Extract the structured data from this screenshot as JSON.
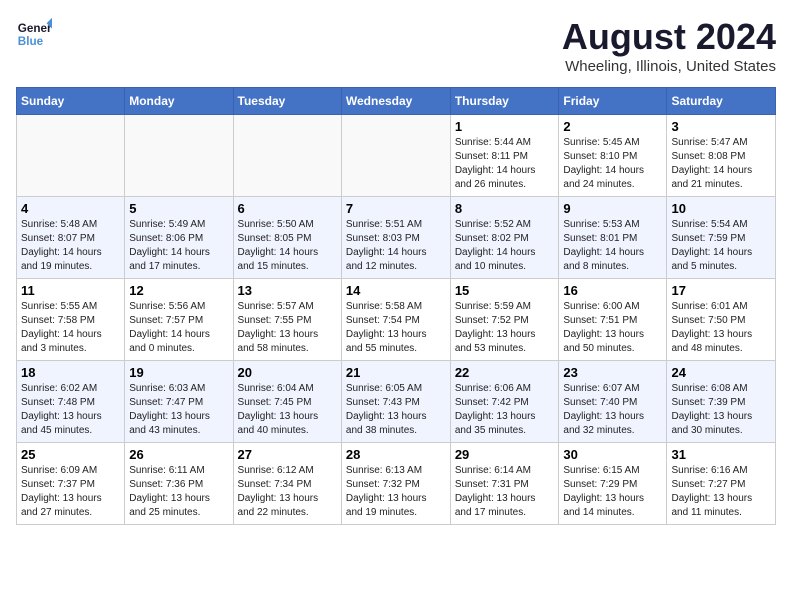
{
  "logo": {
    "line1": "General",
    "line2": "Blue"
  },
  "title": "August 2024",
  "subtitle": "Wheeling, Illinois, United States",
  "weekdays": [
    "Sunday",
    "Monday",
    "Tuesday",
    "Wednesday",
    "Thursday",
    "Friday",
    "Saturday"
  ],
  "weeks": [
    [
      {
        "day": "",
        "info": ""
      },
      {
        "day": "",
        "info": ""
      },
      {
        "day": "",
        "info": ""
      },
      {
        "day": "",
        "info": ""
      },
      {
        "day": "1",
        "info": "Sunrise: 5:44 AM\nSunset: 8:11 PM\nDaylight: 14 hours\nand 26 minutes."
      },
      {
        "day": "2",
        "info": "Sunrise: 5:45 AM\nSunset: 8:10 PM\nDaylight: 14 hours\nand 24 minutes."
      },
      {
        "day": "3",
        "info": "Sunrise: 5:47 AM\nSunset: 8:08 PM\nDaylight: 14 hours\nand 21 minutes."
      }
    ],
    [
      {
        "day": "4",
        "info": "Sunrise: 5:48 AM\nSunset: 8:07 PM\nDaylight: 14 hours\nand 19 minutes."
      },
      {
        "day": "5",
        "info": "Sunrise: 5:49 AM\nSunset: 8:06 PM\nDaylight: 14 hours\nand 17 minutes."
      },
      {
        "day": "6",
        "info": "Sunrise: 5:50 AM\nSunset: 8:05 PM\nDaylight: 14 hours\nand 15 minutes."
      },
      {
        "day": "7",
        "info": "Sunrise: 5:51 AM\nSunset: 8:03 PM\nDaylight: 14 hours\nand 12 minutes."
      },
      {
        "day": "8",
        "info": "Sunrise: 5:52 AM\nSunset: 8:02 PM\nDaylight: 14 hours\nand 10 minutes."
      },
      {
        "day": "9",
        "info": "Sunrise: 5:53 AM\nSunset: 8:01 PM\nDaylight: 14 hours\nand 8 minutes."
      },
      {
        "day": "10",
        "info": "Sunrise: 5:54 AM\nSunset: 7:59 PM\nDaylight: 14 hours\nand 5 minutes."
      }
    ],
    [
      {
        "day": "11",
        "info": "Sunrise: 5:55 AM\nSunset: 7:58 PM\nDaylight: 14 hours\nand 3 minutes."
      },
      {
        "day": "12",
        "info": "Sunrise: 5:56 AM\nSunset: 7:57 PM\nDaylight: 14 hours\nand 0 minutes."
      },
      {
        "day": "13",
        "info": "Sunrise: 5:57 AM\nSunset: 7:55 PM\nDaylight: 13 hours\nand 58 minutes."
      },
      {
        "day": "14",
        "info": "Sunrise: 5:58 AM\nSunset: 7:54 PM\nDaylight: 13 hours\nand 55 minutes."
      },
      {
        "day": "15",
        "info": "Sunrise: 5:59 AM\nSunset: 7:52 PM\nDaylight: 13 hours\nand 53 minutes."
      },
      {
        "day": "16",
        "info": "Sunrise: 6:00 AM\nSunset: 7:51 PM\nDaylight: 13 hours\nand 50 minutes."
      },
      {
        "day": "17",
        "info": "Sunrise: 6:01 AM\nSunset: 7:50 PM\nDaylight: 13 hours\nand 48 minutes."
      }
    ],
    [
      {
        "day": "18",
        "info": "Sunrise: 6:02 AM\nSunset: 7:48 PM\nDaylight: 13 hours\nand 45 minutes."
      },
      {
        "day": "19",
        "info": "Sunrise: 6:03 AM\nSunset: 7:47 PM\nDaylight: 13 hours\nand 43 minutes."
      },
      {
        "day": "20",
        "info": "Sunrise: 6:04 AM\nSunset: 7:45 PM\nDaylight: 13 hours\nand 40 minutes."
      },
      {
        "day": "21",
        "info": "Sunrise: 6:05 AM\nSunset: 7:43 PM\nDaylight: 13 hours\nand 38 minutes."
      },
      {
        "day": "22",
        "info": "Sunrise: 6:06 AM\nSunset: 7:42 PM\nDaylight: 13 hours\nand 35 minutes."
      },
      {
        "day": "23",
        "info": "Sunrise: 6:07 AM\nSunset: 7:40 PM\nDaylight: 13 hours\nand 32 minutes."
      },
      {
        "day": "24",
        "info": "Sunrise: 6:08 AM\nSunset: 7:39 PM\nDaylight: 13 hours\nand 30 minutes."
      }
    ],
    [
      {
        "day": "25",
        "info": "Sunrise: 6:09 AM\nSunset: 7:37 PM\nDaylight: 13 hours\nand 27 minutes."
      },
      {
        "day": "26",
        "info": "Sunrise: 6:11 AM\nSunset: 7:36 PM\nDaylight: 13 hours\nand 25 minutes."
      },
      {
        "day": "27",
        "info": "Sunrise: 6:12 AM\nSunset: 7:34 PM\nDaylight: 13 hours\nand 22 minutes."
      },
      {
        "day": "28",
        "info": "Sunrise: 6:13 AM\nSunset: 7:32 PM\nDaylight: 13 hours\nand 19 minutes."
      },
      {
        "day": "29",
        "info": "Sunrise: 6:14 AM\nSunset: 7:31 PM\nDaylight: 13 hours\nand 17 minutes."
      },
      {
        "day": "30",
        "info": "Sunrise: 6:15 AM\nSunset: 7:29 PM\nDaylight: 13 hours\nand 14 minutes."
      },
      {
        "day": "31",
        "info": "Sunrise: 6:16 AM\nSunset: 7:27 PM\nDaylight: 13 hours\nand 11 minutes."
      }
    ]
  ]
}
